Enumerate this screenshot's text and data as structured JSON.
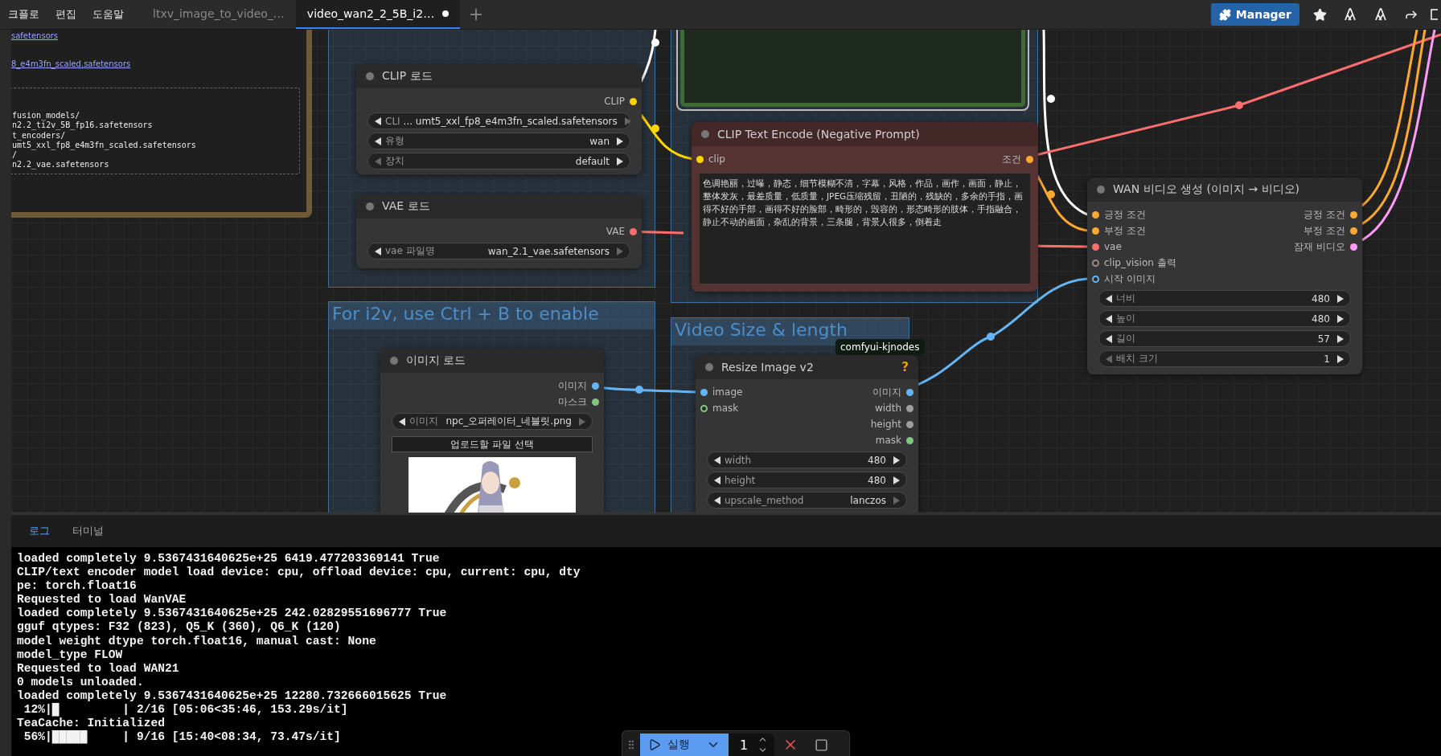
{
  "menu": [
    "크플로",
    "편집",
    "도움말"
  ],
  "tabs": [
    {
      "label": "ltxv_image_to_video_…",
      "selected": false,
      "modified": false
    },
    {
      "label": "video_wan2_2_5B_i2…",
      "selected": true,
      "modified": true
    }
  ],
  "manager_button": "Manager",
  "left_panel": {
    "links": [
      "safetensors",
      "8_e4m3fn_scaled.safetensors"
    ],
    "listing": [
      "fusion_models/",
      "n2.2_ti2v_5B_fp16.safetensors",
      "t_encoders/",
      "umt5_xxl_fp8_e4m3fn_scaled.safetensors",
      "/",
      "n2.2_vae.safetensors"
    ]
  },
  "groups": [
    {
      "title": "For i2v, use Ctrl + B to enable"
    },
    {
      "title": "Video Size & length"
    }
  ],
  "nodes": [
    {
      "title": "CLIP 로드",
      "color": "#353535",
      "outputs": [
        {
          "label": "CLIP",
          "color": "#ffd500",
          "optional": false
        }
      ],
      "widgets": [
        {
          "label": "CLI",
          "value": "... umt5_xxl_fp8_e4m3fn_scaled.safetensors",
          "at_min": false,
          "at_max": true
        },
        {
          "label": "유형",
          "value": "wan",
          "at_min": false,
          "at_max": false
        },
        {
          "label": "장치",
          "value": "default",
          "at_min": true,
          "at_max": false
        }
      ]
    },
    {
      "title": "VAE 로드",
      "color": "#353535",
      "outputs": [
        {
          "label": "VAE",
          "color": "#ff6e6e",
          "optional": false
        }
      ],
      "widgets": [
        {
          "label": "vae 파일명",
          "value": "wan_2.1_vae.safetensors",
          "at_min": false,
          "at_max": true
        }
      ]
    },
    {
      "title": "이미지 로드",
      "color": "#353535",
      "outputs": [
        {
          "label": "이미지",
          "color": "#64b5f6",
          "optional": false
        },
        {
          "label": "마스크",
          "color": "#81c784",
          "optional": false
        }
      ],
      "widgets": [
        {
          "label": "이미지",
          "value": "npc_오퍼레이터_네블릿.png",
          "at_min": false,
          "at_max": true
        }
      ],
      "button": "업로드할 파일 선택",
      "preview": {
        "kind": "picture"
      }
    },
    {
      "title": "CLIP Text Encode (Negative Prompt)",
      "color": "#553333",
      "inputs": [
        {
          "label": "clip",
          "color": "#ffd500",
          "optional": false
        }
      ],
      "outputs": [
        {
          "label": "조건",
          "color": "#ffa931",
          "optional": false
        }
      ],
      "text": "色调艳丽，过曝，静态，细节模糊不清，字幕，风格，作品，画作，画面，静止，整体发灰，最差质量，低质量，JPEG压缩残留，丑陋的，残缺的，多余的手指，画得不好的手部，画得不好的脸部，畸形的，毁容的，形态畸形的肢体，手指融合，静止不动的画面，杂乱的背景，三条腿，背景人很多，倒着走"
    },
    {
      "title": "Resize Image v2",
      "color": "#353535",
      "help": "?",
      "badge": "comfyui-kjnodes",
      "inputs": [
        {
          "label": "image",
          "color": "#64b5f6",
          "optional": false
        },
        {
          "label": "mask",
          "color": "#81c784",
          "optional": true
        }
      ],
      "outputs": [
        {
          "label": "이미지",
          "color": "#64b5f6",
          "optional": false
        },
        {
          "label": "width",
          "color": "#9e9e9e",
          "optional": false
        },
        {
          "label": "height",
          "color": "#9e9e9e",
          "optional": false
        },
        {
          "label": "mask",
          "color": "#81c784",
          "optional": false
        }
      ],
      "widgets": [
        {
          "label": "width",
          "value": "480",
          "at_min": false,
          "at_max": false
        },
        {
          "label": "height",
          "value": "480",
          "at_min": false,
          "at_max": false
        },
        {
          "label": "upscale_method",
          "value": "lanczos",
          "at_min": false,
          "at_max": true
        }
      ]
    },
    {
      "title": "WAN 비디오 생성 (이미지 → 비디오)",
      "color": "#353535",
      "inputs": [
        {
          "label": "긍정 조건",
          "color": "#ffa931",
          "optional": false
        },
        {
          "label": "부정 조건",
          "color": "#ffa931",
          "optional": false
        },
        {
          "label": "vae",
          "color": "#ff6e6e",
          "optional": false
        },
        {
          "label": "clip_vision 출력",
          "color": "#a1887f",
          "optional": true
        },
        {
          "label": "시작 이미지",
          "color": "#64b5f6",
          "optional": true
        }
      ],
      "outputs": [
        {
          "label": "긍정 조건",
          "color": "#ffa931",
          "optional": false
        },
        {
          "label": "부정 조건",
          "color": "#ffa931",
          "optional": false
        },
        {
          "label": "잠재 비디오",
          "color": "#ff9cf9",
          "optional": false
        }
      ],
      "widgets": [
        {
          "label": "너비",
          "value": "480",
          "at_min": false,
          "at_max": false
        },
        {
          "label": "높이",
          "value": "480",
          "at_min": false,
          "at_max": false
        },
        {
          "label": "길이",
          "value": "57",
          "at_min": false,
          "at_max": false
        },
        {
          "label": "배치 크기",
          "value": "1",
          "at_min": true,
          "at_max": false
        }
      ]
    }
  ],
  "panel_tabs": [
    {
      "label": "로그",
      "selected": true
    },
    {
      "label": "터미널",
      "selected": false
    }
  ],
  "log": [
    "loaded completely 9.5367431640625e+25 6419.477203369141 True",
    "CLIP/text encoder model load device: cpu, offload device: cpu, current: cpu, dty",
    "pe: torch.float16",
    "Requested to load WanVAE",
    "loaded completely 9.5367431640625e+25 242.02829551696777 True",
    "gguf qtypes: F32 (823), Q5_K (360), Q6_K (120)",
    "model weight dtype torch.float16, manual cast: None",
    "model_type FLOW",
    "Requested to load WAN21",
    "0 models unloaded.",
    "loaded completely 9.5367431640625e+25 12280.732666015625 True",
    " 12%|█         | 2/16 [05:06<35:46, 153.29s/it]",
    "TeaCache: Initialized",
    " 56%|█████     | 9/16 [15:40<08:34, 73.47s/it]"
  ],
  "run_bar": {
    "label": "실행",
    "count": "1"
  }
}
